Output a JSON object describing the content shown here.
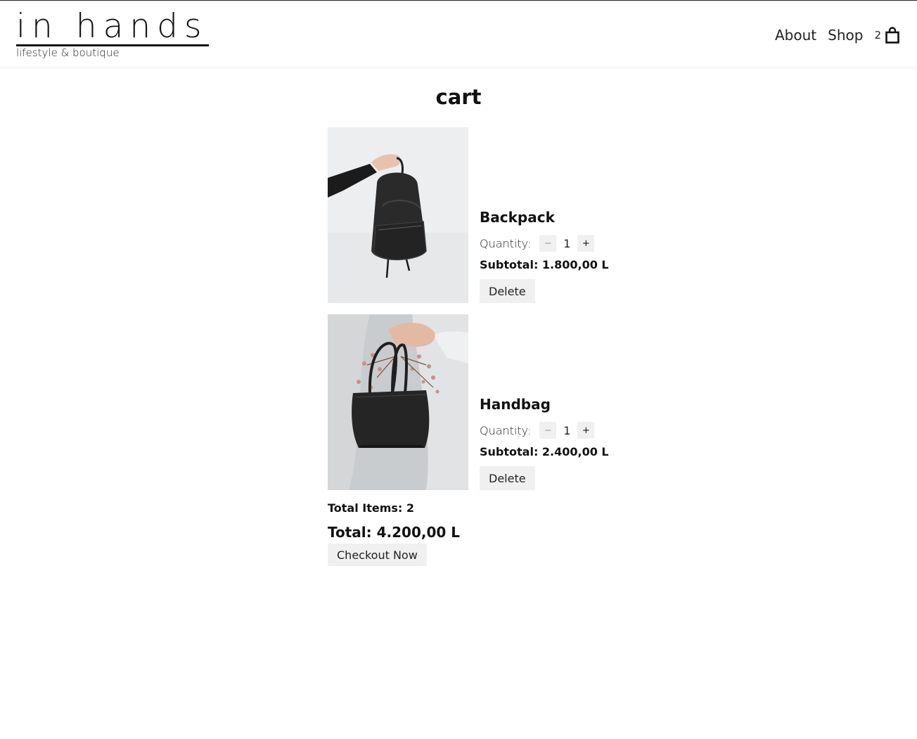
{
  "brand": {
    "name": "in hands",
    "tagline": "lifestyle & boutique"
  },
  "nav": {
    "about": "About",
    "shop": "Shop",
    "cart_count": "2",
    "cart_icon": "shopping-bag-icon"
  },
  "page": {
    "title": "cart"
  },
  "cart": {
    "quantity_label": "Quantity:",
    "minus_label": "−",
    "plus_label": "+",
    "delete_label": "Delete",
    "items": [
      {
        "name": "Backpack",
        "quantity": "1",
        "subtotal": "Subtotal: 1.800,00 L"
      },
      {
        "name": "Handbag",
        "quantity": "1",
        "subtotal": "Subtotal: 2.400,00 L"
      }
    ],
    "total_items": "Total Items: 2",
    "total": "Total: 4.200,00 L",
    "checkout_label": "Checkout Now"
  }
}
